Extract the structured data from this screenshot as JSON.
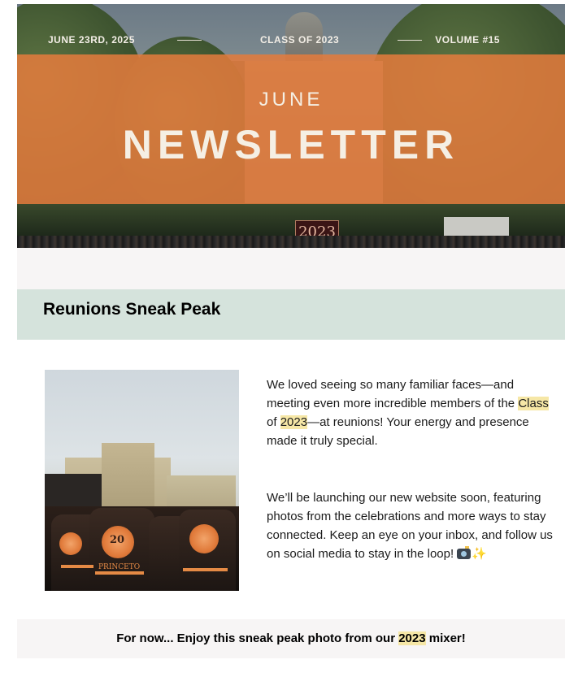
{
  "hero": {
    "date": "JUNE 23RD, 2025",
    "class_label": "CLASS OF 2023",
    "volume": "VOLUME #15",
    "month": "JUNE",
    "title": "NEWSLETTER",
    "sign_text": "2023",
    "band_color": "#e47c3c"
  },
  "section": {
    "heading": "Reunions Sneak Peak",
    "heading_bg": "#d5e3dc"
  },
  "photo": {
    "jacket_text_1": "PRINCETO",
    "jacket_text_2": "20"
  },
  "body": {
    "p1_a": "We loved seeing so many familiar faces—and meeting even more incredible members of the ",
    "p1_hl1": "Class",
    "p1_b": " of ",
    "p1_hl2": "2023",
    "p1_c": "—at reunions! Your energy and presence made it truly special.",
    "p2": "We’ll be launching our new website soon, featuring photos from the celebrations and more ways to stay connected. Keep an eye on your inbox, and follow us on social media to stay in the loop!",
    "icons": [
      "camera-icon",
      "sparkle-icon"
    ],
    "highlight_color": "#f6e7a6"
  },
  "footer": {
    "text_a": "For now... Enjoy this sneak peak photo from our ",
    "text_hl": "2023",
    "text_b": " mixer!"
  }
}
